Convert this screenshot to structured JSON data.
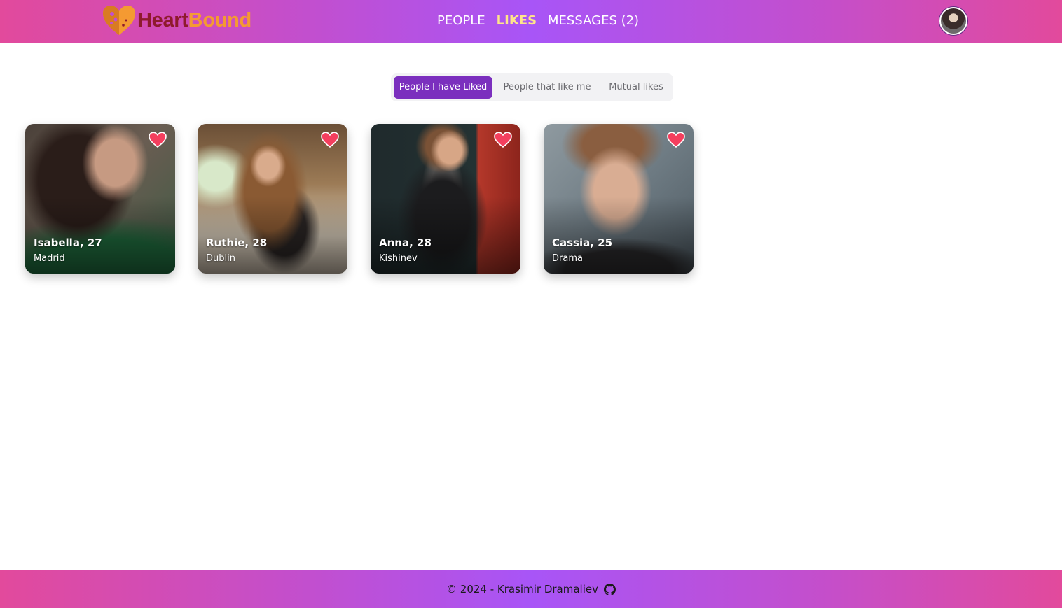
{
  "brand": {
    "name_part1": "Heart",
    "name_part2": "Bound",
    "logo_icon": "heart-logo-icon"
  },
  "nav": {
    "links": [
      {
        "label": "PEOPLE",
        "active": false
      },
      {
        "label": "LIKES",
        "active": true
      },
      {
        "label": "MESSAGES (2)",
        "active": false
      }
    ],
    "avatar_icon": "user-avatar"
  },
  "tabs": [
    {
      "label": "People I have Liked",
      "active": true
    },
    {
      "label": "People that like me",
      "active": false
    },
    {
      "label": "Mutual likes",
      "active": false
    }
  ],
  "profiles": [
    {
      "name_age": "Isabella, 27",
      "city": "Madrid",
      "liked": true
    },
    {
      "name_age": "Ruthie, 28",
      "city": "Dublin",
      "liked": true
    },
    {
      "name_age": "Anna, 28",
      "city": "Kishinev",
      "liked": true
    },
    {
      "name_age": "Cassia, 25",
      "city": "Drama",
      "liked": true
    }
  ],
  "footer": {
    "text": "© 2024 - Krasimir Dramaliev",
    "icon": "github-icon"
  },
  "colors": {
    "brand_pink": "#e24a9c",
    "brand_purple": "#a855f7",
    "active_tab": "#7b2fbe",
    "active_nav": "#ffe58a",
    "like_heart": "#f43f5e"
  }
}
